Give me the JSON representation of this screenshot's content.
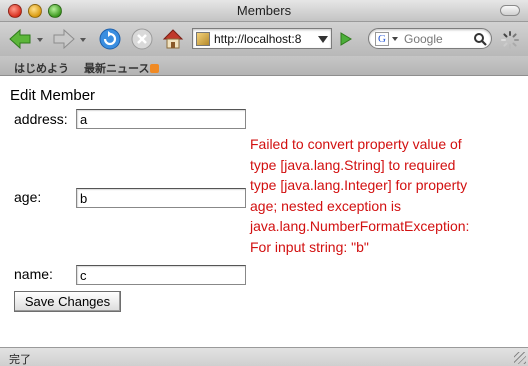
{
  "window": {
    "title": "Members"
  },
  "toolbar": {
    "url": "http://localhost:8",
    "search_placeholder": "Google",
    "search_engine_letter": "G"
  },
  "bookmarks": [
    {
      "label": "はじめよう"
    },
    {
      "label": "最新ニュース"
    }
  ],
  "form": {
    "heading": "Edit Member",
    "address_label": "address:",
    "address_value": "a",
    "age_label": "age:",
    "age_value": "b",
    "name_label": "name:",
    "name_value": "c",
    "submit_label": "Save Changes",
    "error_lines": [
      "Failed to convert property value of",
      "type [java.lang.String] to required",
      "type [java.lang.Integer] for property",
      "age; nested exception is",
      "java.lang.NumberFormatException:",
      "For input string: \"b\""
    ]
  },
  "status": {
    "text": "完了"
  },
  "colors": {
    "error": "#d21010",
    "titlebar": "#c4c4c4"
  }
}
